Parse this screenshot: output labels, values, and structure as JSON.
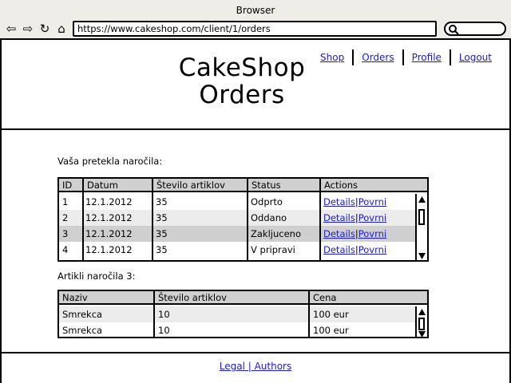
{
  "browser": {
    "window_title": "Browser",
    "url": "https://www.cakeshop.com/client/1/orders"
  },
  "header": {
    "title_line1": "CakeShop",
    "title_line2": "Orders",
    "nav": [
      "Shop",
      "Orders",
      "Profile",
      "Logout"
    ]
  },
  "orders_section": {
    "label": "Vaša pretekla naročila:",
    "columns": [
      "ID",
      "Datum",
      "Število artiklov",
      "Status",
      "Actions"
    ],
    "rows": [
      {
        "id": "1",
        "date": "12.1.2012",
        "count": "35",
        "status": "Odprto"
      },
      {
        "id": "2",
        "date": "12.1.2012",
        "count": "35",
        "status": "Oddano"
      },
      {
        "id": "3",
        "date": "12.1.2012",
        "count": "35",
        "status": "Zakljuceno"
      },
      {
        "id": "4",
        "date": "12.1.2012",
        "count": "35",
        "status": "V pripravi"
      }
    ],
    "action_details": "Details",
    "action_sep": "|",
    "action_return": "Povrni"
  },
  "items_section": {
    "label": "Artikli naročila 3:",
    "columns": [
      "Naziv",
      "Število artiklov",
      "Cena"
    ],
    "rows": [
      {
        "name": "Smrekca",
        "count": "10",
        "price": "100 eur"
      },
      {
        "name": "Smrekca",
        "count": "10",
        "price": "100 eur"
      }
    ]
  },
  "footer": {
    "links": "Legal | Authors"
  }
}
